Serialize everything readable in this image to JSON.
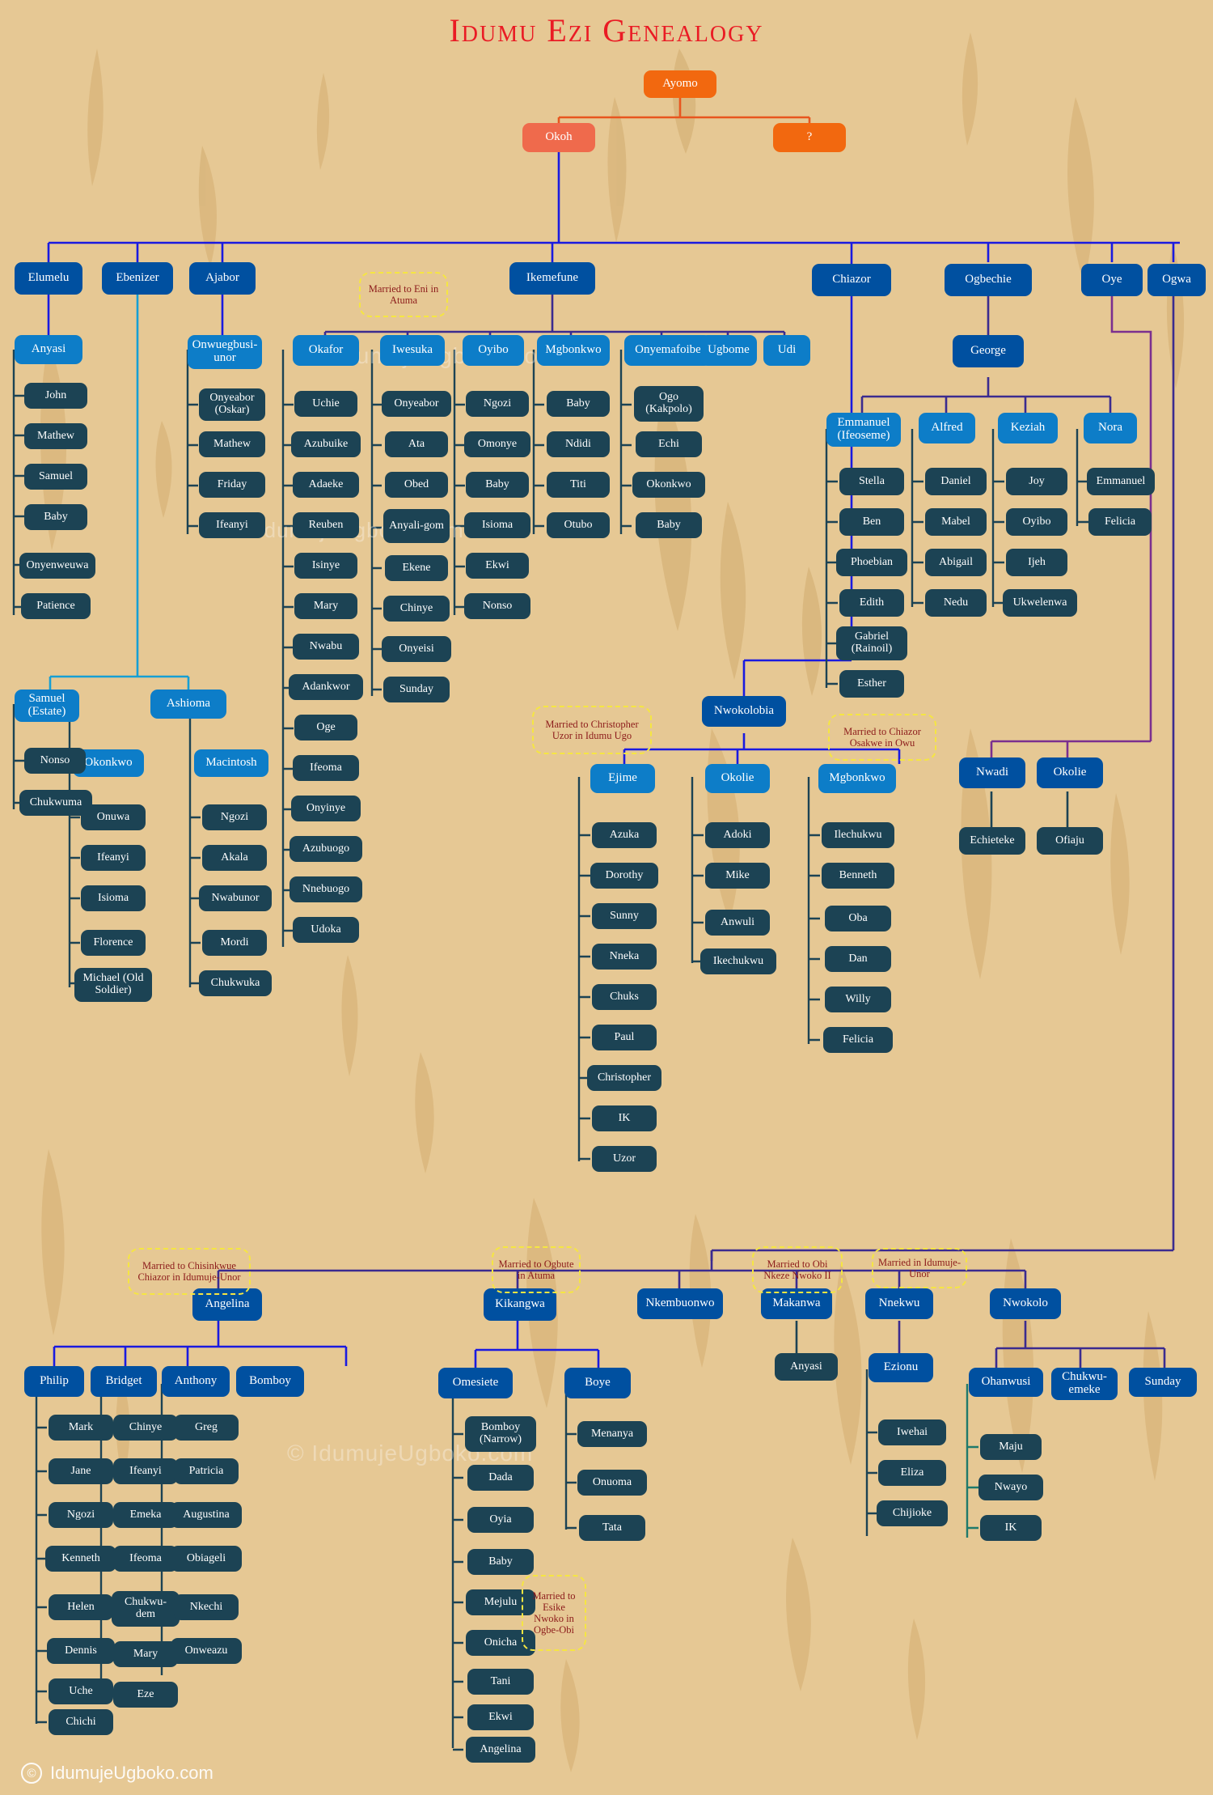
{
  "title": "Idumu Ezi Genealogy",
  "footer": {
    "copyright_symbol": "©",
    "site": "IdumujeUgboko.com"
  },
  "watermarks": [
    "© IdumujeUgboko.com",
    "© IdumujeUgboko.com",
    "© IdumujeUgboko.com"
  ],
  "colors": {
    "background": "#e6c894",
    "title": "#ea1b24",
    "root": "#f2680f",
    "root_alt": "#ef6a4c",
    "gen1": "#0050a0",
    "gen2": "#0d7dc8",
    "leaf": "#1c4354",
    "note_border": "#f5e642",
    "note_text": "#8c1b1b",
    "link_blue": "#1a1ae0",
    "link_navy": "#2b2b8f",
    "link_purple": "#7b2f8f",
    "link_dark": "#1c4354",
    "link_teal": "#1f7a6b"
  },
  "nodes": {
    "ayomo": "Ayomo",
    "okoh": "Okoh",
    "unknown": "?",
    "elumelu": "Elumelu",
    "ebenizer": "Ebenizer",
    "ajabor": "Ajabor",
    "ikemefune": "Ikemefune",
    "chiazor": "Chiazor",
    "ogbechie": "Ogbechie",
    "oye": "Oye",
    "ogwa": "Ogwa",
    "anyasi": "Anyasi",
    "onwuegbusi_unor": "Onwuegbusi-unor",
    "okafor": "Okafor",
    "iwesuka": "Iwesuka",
    "oyibo": "Oyibo",
    "mgbonkwo_ike": "Mgbonkwo",
    "onyemafoibe": "Onyemafoibe",
    "ugbome": "Ugbome",
    "udi": "Udi",
    "george": "George",
    "emmanuel_ifeoseme": "Emmanuel (Ifeoseme)",
    "alfred": "Alfred",
    "keziah": "Keziah",
    "nora": "Nora",
    "samuel_estate": "Samuel (Estate)",
    "ashioma": "Ashioma",
    "okonkwo_a": "Okonkwo",
    "macintosh": "Macintosh",
    "nwokolobia": "Nwokolobia",
    "ejime": "Ejime",
    "okolie_m": "Okolie",
    "mgbonkwo_n": "Mgbonkwo",
    "nwadi": "Nwadi",
    "okolie_o": "Okolie",
    "angelina_top": "Angelina",
    "kikangwa": "Kikangwa",
    "nkembuonwo": "Nkembuonwo",
    "makanwa": "Makanwa",
    "nnekwu": "Nnekwu",
    "nwokolo": "Nwokolo",
    "philip": "Philip",
    "bridget": "Bridget",
    "anthony": "Anthony",
    "bomboy": "Bomboy",
    "omesiete": "Omesiete",
    "boye": "Boye",
    "anyasi_b": "Anyasi",
    "ezionu": "Ezionu",
    "ohanwusi": "Ohanwusi",
    "chukwuemeke": "Chukwu-emeke",
    "sunday_n": "Sunday"
  },
  "notes": {
    "eni_atuma": "Married to Eni in Atuma",
    "christopher_uzor": "Married to Christopher Uzor in Idumu Ugo",
    "chiazor_osakwe": "Married to Chiazor Osakwe in Owu",
    "chisinkwue": "Married to Chisinkwue Chiazor in Idumuje-Unor",
    "ogbute_atuma": "Married to Ogbute in Atuma",
    "obi_nkeze": "Married to Obi Nkeze Nwoko II",
    "idumuje_unor": "Married in Idumuje-Unor",
    "esike_nwoko": "Married to Esike Nwoko in Ogbe-Obi"
  },
  "children": {
    "anyasi": [
      "John",
      "Mathew",
      "Samuel",
      "Baby",
      "Onyenweuwa",
      "Patience"
    ],
    "onwuegbusi_unor": [
      "Onyeabor (Oskar)",
      "Mathew",
      "Friday",
      "Ifeanyi"
    ],
    "okafor": [
      "Uchie",
      "Azubuike",
      "Adaeke",
      "Reuben",
      "Isinye",
      "Mary",
      "Nwabu",
      "Adankwor",
      "Oge",
      "Ifeoma",
      "Onyinye",
      "Azubuogo",
      "Nnebuogo",
      "Udoka"
    ],
    "iwesuka": [
      "Onyeabor",
      "Ata",
      "Obed",
      "Anyali-gom",
      "Ekene",
      "Chinye",
      "Onyeisi",
      "Sunday"
    ],
    "oyibo": [
      "Ngozi",
      "Omonye",
      "Baby",
      "Isioma",
      "Ekwi",
      "Nonso"
    ],
    "mgbonkwo_ike": [
      "Baby",
      "Ndidi",
      "Titi",
      "Otubo"
    ],
    "onyemafoibe": [
      "Ogo (Kakpolo)",
      "Echi",
      "Okonkwo",
      "Baby"
    ],
    "emmanuel_ifeoseme": [
      "Stella",
      "Ben",
      "Phoebian",
      "Edith",
      "Gabriel (Rainoil)",
      "Esther"
    ],
    "alfred": [
      "Daniel",
      "Mabel",
      "Abigail",
      "Nedu"
    ],
    "keziah": [
      "Joy",
      "Oyibo",
      "Ijeh",
      "Ukwelenwa"
    ],
    "nora": [
      "Emmanuel",
      "Felicia"
    ],
    "samuel_estate": [
      "Nonso",
      "Chukwuma"
    ],
    "okonkwo_a": [
      "Onuwa",
      "Ifeanyi",
      "Isioma",
      "Florence",
      "Michael (Old Soldier)"
    ],
    "macintosh": [
      "Ngozi",
      "Akala",
      "Nwabunor",
      "Mordi",
      "Chukwuka"
    ],
    "ejime": [
      "Azuka",
      "Dorothy",
      "Sunny",
      "Nneka",
      "Chuks",
      "Paul",
      "Christopher",
      "IK",
      "Uzor"
    ],
    "okolie_m": [
      "Adoki",
      "Mike",
      "Anwuli",
      "Ikechukwu"
    ],
    "mgbonkwo_n": [
      "Ilechukwu",
      "Benneth",
      "Oba",
      "Dan",
      "Willy",
      "Felicia"
    ],
    "nwadi": [
      "Echieteke"
    ],
    "okolie_o": [
      "Ofiaju"
    ],
    "philip": [
      "Mark",
      "Jane",
      "Ngozi",
      "Kenneth",
      "Helen",
      "Dennis",
      "Uche",
      "Chichi"
    ],
    "bridget": [
      "Chinye",
      "Ifeanyi",
      "Emeka",
      "Ifeoma",
      "Chukwu-dem",
      "Mary",
      "Eze"
    ],
    "anthony": [
      "Greg",
      "Patricia",
      "Augustina",
      "Obiageli",
      "Nkechi",
      "Onweazu"
    ],
    "omesiete": [
      "Bomboy (Narrow)",
      "Dada",
      "Oyia",
      "Baby",
      "Mejulu",
      "Onicha",
      "Tani",
      "Ekwi",
      "Angelina"
    ],
    "boye": [
      "Menanya",
      "Onuoma",
      "Tata"
    ],
    "makanwa": [
      "Anyasi"
    ],
    "ezionu": [
      "Iwehai",
      "Eliza",
      "Chijioke"
    ],
    "ohanwusi": [
      "Maju",
      "Nwayo",
      "IK"
    ]
  }
}
